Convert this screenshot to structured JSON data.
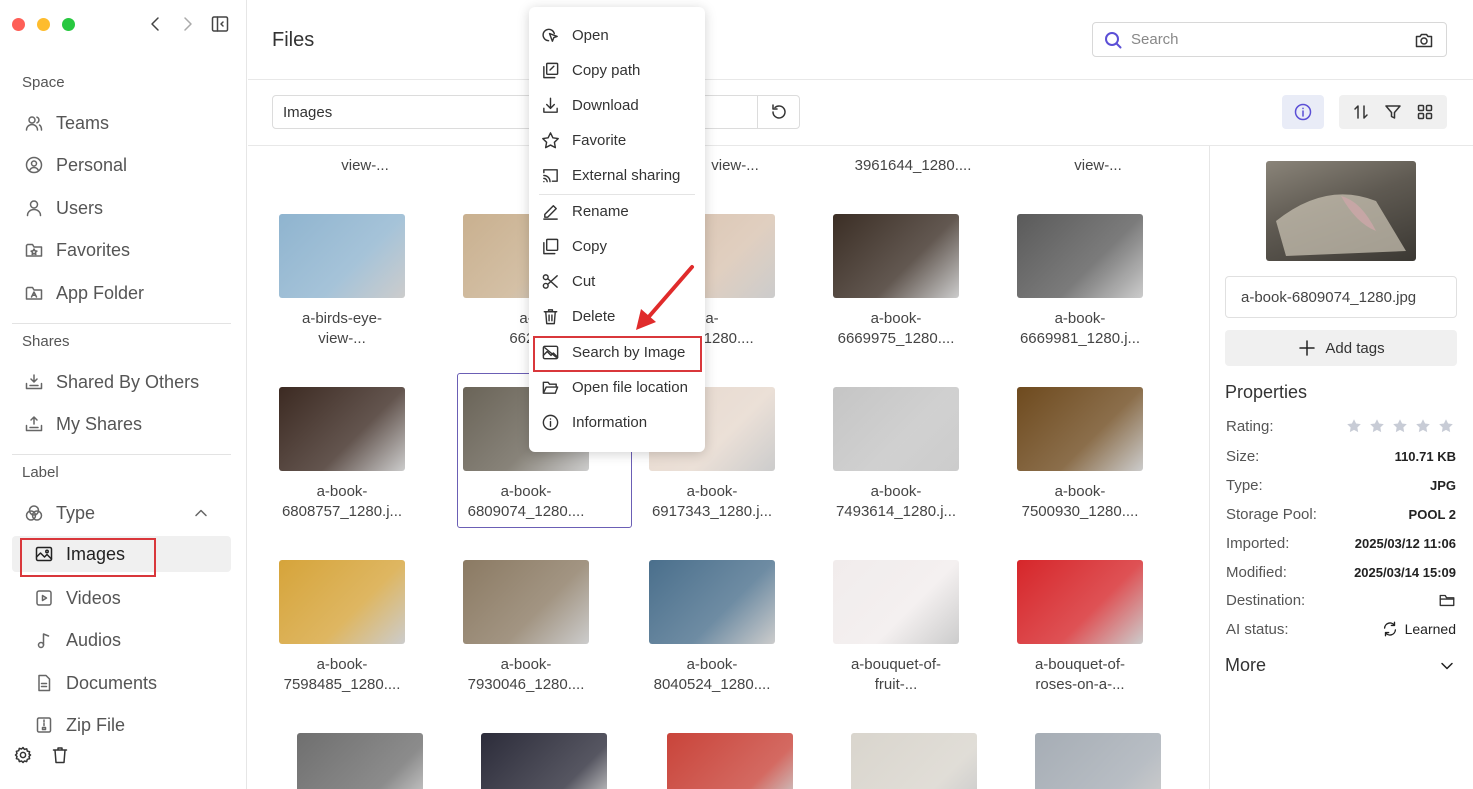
{
  "window": {
    "title": "Files"
  },
  "sidebar": {
    "space_heading": "Space",
    "space_items": [
      {
        "label": "Teams",
        "icon": "users-icon"
      },
      {
        "label": "Personal",
        "icon": "user-circle-icon"
      },
      {
        "label": "Users",
        "icon": "user-icon"
      },
      {
        "label": "Favorites",
        "icon": "star-folder-icon"
      },
      {
        "label": "App Folder",
        "icon": "app-folder-icon"
      }
    ],
    "shares_heading": "Shares",
    "shares_items": [
      {
        "label": "Shared By Others",
        "icon": "inbox-in-icon"
      },
      {
        "label": "My Shares",
        "icon": "inbox-out-icon"
      }
    ],
    "label_heading": "Label",
    "type_label": "Type",
    "type_items": [
      {
        "label": "Images",
        "icon": "image-icon",
        "active": true
      },
      {
        "label": "Videos",
        "icon": "video-icon"
      },
      {
        "label": "Audios",
        "icon": "music-icon"
      },
      {
        "label": "Documents",
        "icon": "document-icon"
      },
      {
        "label": "Zip File",
        "icon": "zip-icon"
      }
    ]
  },
  "search": {
    "placeholder": "Search"
  },
  "toolbar": {
    "path": "Images"
  },
  "grid": {
    "top_captions": [
      "view-...",
      "v",
      "view-...",
      "3961644_1280....",
      "view-..."
    ],
    "rows": [
      [
        {
          "line1": "a-birds-eye-",
          "line2": "view-...",
          "color": "#8fb4cf"
        },
        {
          "line1": "a-",
          "line2": "6626",
          "color": "#c9b08f"
        },
        {
          "line1": "a-",
          "line2": "663_1280....",
          "color": "#d9c3b0"
        },
        {
          "line1": "a-book-",
          "line2": "6669975_1280....",
          "color": "#3b2e25"
        },
        {
          "line1": "a-book-",
          "line2": "6669981_1280.j...",
          "color": "#5a5a5a"
        }
      ],
      [
        {
          "line1": "a-book-",
          "line2": "6808757_1280.j...",
          "color": "#3c2a22"
        },
        {
          "line1": "a-book-",
          "line2": "6809074_1280....",
          "color": "#6a6458"
        },
        {
          "line1": "a-book-",
          "line2": "6917343_1280.j...",
          "color": "#e6d8cd"
        },
        {
          "line1": "a-book-",
          "line2": "7493614_1280.j...",
          "color": "#c5c5c5"
        },
        {
          "line1": "a-book-",
          "line2": "7500930_1280....",
          "color": "#6e4a1e"
        }
      ],
      [
        {
          "line1": "a-book-",
          "line2": "7598485_1280....",
          "color": "#d6a43a"
        },
        {
          "line1": "a-book-",
          "line2": "7930046_1280....",
          "color": "#8b7a63"
        },
        {
          "line1": "a-book-",
          "line2": "8040524_1280....",
          "color": "#4a6f8c"
        },
        {
          "line1": "a-bouquet-of-",
          "line2": "fruit-...",
          "color": "#f1ecec"
        },
        {
          "line1": "a-bouquet-of-",
          "line2": "roses-on-a-...",
          "color": "#d6262a"
        }
      ]
    ],
    "bottom_colors": [
      "#6f6f6f",
      "#2c2c3a",
      "#c9443a",
      "#d9d5cd",
      "#a6adb5"
    ]
  },
  "context_menu": {
    "items": [
      {
        "label": "Open",
        "icon": "cursor-click-icon"
      },
      {
        "label": "Copy path",
        "icon": "copy-path-icon"
      },
      {
        "label": "Download",
        "icon": "download-icon"
      },
      {
        "label": "Favorite",
        "icon": "star-icon"
      },
      {
        "label": "External sharing",
        "icon": "cast-icon"
      },
      {
        "label": "Rename",
        "icon": "pencil-icon"
      },
      {
        "label": "Copy",
        "icon": "copy-icon"
      },
      {
        "label": "Cut",
        "icon": "scissors-icon"
      },
      {
        "label": "Delete",
        "icon": "trash-icon"
      },
      {
        "label": "Search by Image",
        "icon": "image-search-icon"
      },
      {
        "label": "Open file location",
        "icon": "folder-open-icon"
      },
      {
        "label": "Information",
        "icon": "info-icon"
      }
    ]
  },
  "details": {
    "filename": "a-book-6809074_1280.jpg",
    "add_tags": "Add tags",
    "properties_heading": "Properties",
    "rating_label": "Rating:",
    "rating": 0,
    "props": [
      {
        "key": "Size:",
        "value": "110.71 KB"
      },
      {
        "key": "Type:",
        "value": "JPG"
      },
      {
        "key": "Storage Pool:",
        "value": "POOL 2"
      },
      {
        "key": "Imported:",
        "value": "2025/03/12 11:06"
      },
      {
        "key": "Modified:",
        "value": "2025/03/14 15:09"
      }
    ],
    "destination_label": "Destination:",
    "ai_status_label": "AI status:",
    "ai_status_value": "Learned",
    "more_label": "More"
  },
  "colors": {
    "accent": "#5b4fd6",
    "highlight": "#d9373b",
    "selection": "#6b5fb5",
    "close": "#fe5f57",
    "minimize": "#febc2e",
    "maximize": "#28c840"
  }
}
